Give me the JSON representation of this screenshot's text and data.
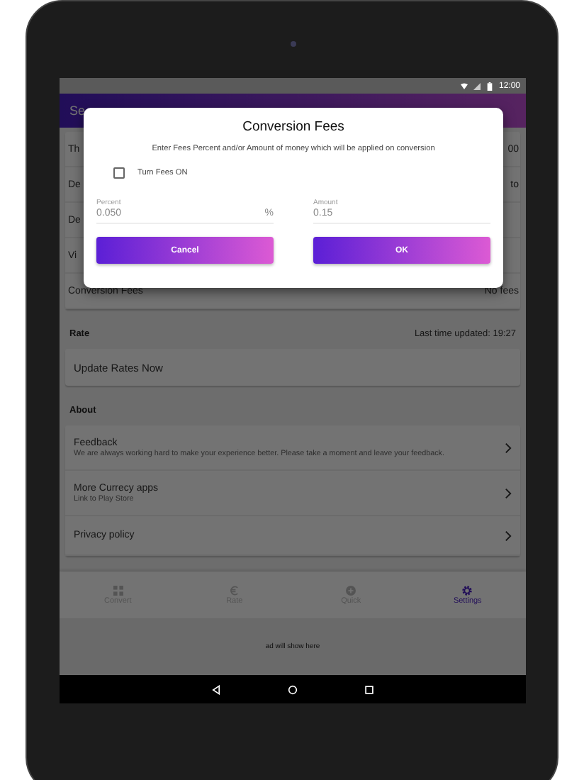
{
  "status_bar": {
    "time": "12:00"
  },
  "app_bar": {
    "title": "Se"
  },
  "settings_rows": [
    {
      "label": "Th",
      "value": "00"
    },
    {
      "label": "De",
      "value": "to"
    },
    {
      "label": "De"
    },
    {
      "label": "Vi"
    },
    {
      "label": "Conversion Fees",
      "value": "No fees"
    }
  ],
  "rate_section": {
    "header": "Rate",
    "last_updated": "Last time updated: 19:27",
    "action": "Update Rates Now"
  },
  "about_section": {
    "header": "About",
    "items": [
      {
        "title": "Feedback",
        "subtitle": "We are always working hard to make your experience better. Please take a moment and leave your feedback."
      },
      {
        "title": "More Currecy apps",
        "subtitle": "Link to Play Store"
      },
      {
        "title": "Privacy policy"
      }
    ]
  },
  "bottom_nav": [
    {
      "label": "Convert",
      "kind": "grid",
      "selected": false
    },
    {
      "label": "Rate",
      "kind": "euro",
      "selected": false
    },
    {
      "label": "Quick",
      "kind": "circle",
      "selected": false
    },
    {
      "label": "Settings",
      "kind": "gear",
      "selected": true
    }
  ],
  "ad_banner": "ad will show here",
  "dialog": {
    "title": "Conversion Fees",
    "description": "Enter Fees Percent and/or Amount of money which will be applied on conversion",
    "checkbox": {
      "label": "Turn Fees ON",
      "checked": false
    },
    "fields": [
      {
        "label": "Percent",
        "value": "0.050",
        "suffix": "%"
      },
      {
        "label": "Amount",
        "value": "0.15"
      }
    ],
    "buttons": [
      "Cancel",
      "OK"
    ]
  }
}
